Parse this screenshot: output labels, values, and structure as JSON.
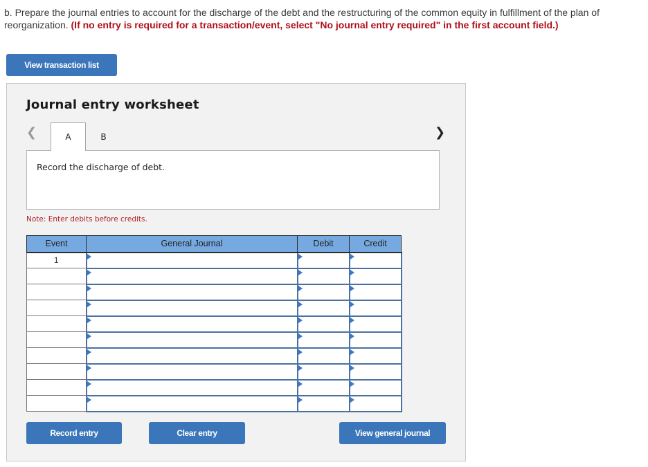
{
  "instructions": {
    "text": "b. Prepare the journal entries to account for the discharge of the debt and the restructuring of the common equity in fulfillment of the plan of reorganization.",
    "emphasis": "(If no entry is required for a transaction/event, select \"No journal entry required\" in the first account field.)"
  },
  "buttons": {
    "view_transaction_list": "View transaction list",
    "record_entry": "Record entry",
    "clear_entry": "Clear entry",
    "view_general_journal": "View general journal"
  },
  "worksheet": {
    "title": "Journal entry worksheet",
    "nav_prev_icon": "‹",
    "nav_next_icon": "›",
    "tabs": [
      {
        "label": "A",
        "active": true
      },
      {
        "label": "B",
        "active": false
      }
    ],
    "description": "Record the discharge of debt.",
    "note": "Note: Enter debits before credits."
  },
  "table": {
    "headers": {
      "event": "Event",
      "general_journal": "General Journal",
      "debit": "Debit",
      "credit": "Credit"
    },
    "rows": [
      {
        "event": "1",
        "account": "",
        "debit": "",
        "credit": ""
      },
      {
        "event": "",
        "account": "",
        "debit": "",
        "credit": ""
      },
      {
        "event": "",
        "account": "",
        "debit": "",
        "credit": ""
      },
      {
        "event": "",
        "account": "",
        "debit": "",
        "credit": ""
      },
      {
        "event": "",
        "account": "",
        "debit": "",
        "credit": ""
      },
      {
        "event": "",
        "account": "",
        "debit": "",
        "credit": ""
      },
      {
        "event": "",
        "account": "",
        "debit": "",
        "credit": ""
      },
      {
        "event": "",
        "account": "",
        "debit": "",
        "credit": ""
      },
      {
        "event": "",
        "account": "",
        "debit": "",
        "credit": ""
      },
      {
        "event": "",
        "account": "",
        "debit": "",
        "credit": ""
      }
    ]
  }
}
